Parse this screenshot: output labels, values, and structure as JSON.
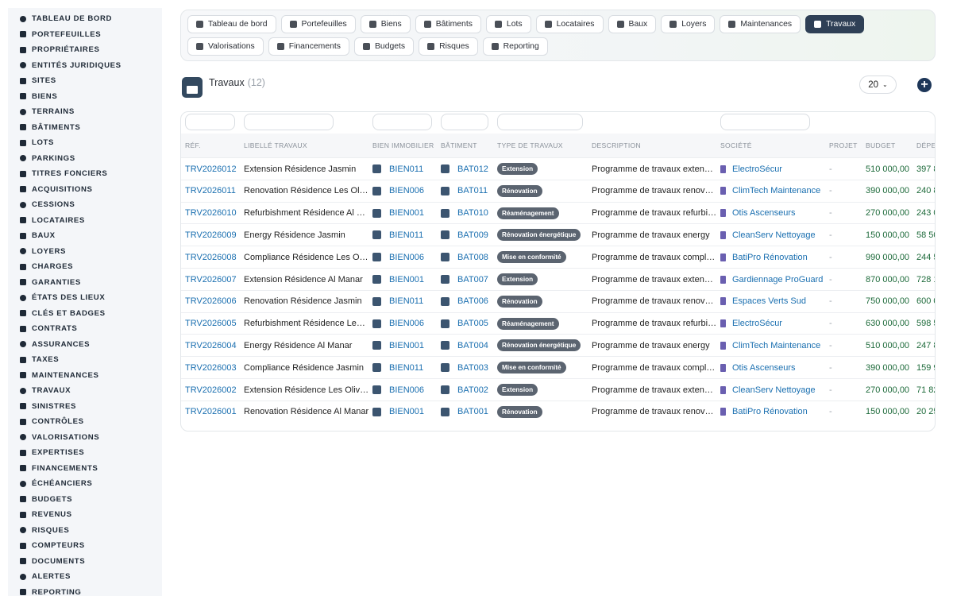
{
  "sidebar": {
    "items": [
      {
        "label": "TABLEAU DE BORD",
        "icon": "gauge-icon"
      },
      {
        "label": "PORTEFEUILLES",
        "icon": "briefcase-icon"
      },
      {
        "label": "PROPRIÉTAIRES",
        "icon": "user-tie-icon"
      },
      {
        "label": "ENTITÉS JURIDIQUES",
        "icon": "landmark-icon"
      },
      {
        "label": "SITES",
        "icon": "city-icon"
      },
      {
        "label": "BIENS",
        "icon": "building-icon"
      },
      {
        "label": "TERRAINS",
        "icon": "vector-square-icon"
      },
      {
        "label": "BÂTIMENTS",
        "icon": "industry-icon"
      },
      {
        "label": "LOTS",
        "icon": "grid-icon"
      },
      {
        "label": "PARKINGS",
        "icon": "parking-icon"
      },
      {
        "label": "TITRES FONCIERS",
        "icon": "file-signature-icon"
      },
      {
        "label": "ACQUISITIONS",
        "icon": "handshake-icon"
      },
      {
        "label": "CESSIONS",
        "icon": "exchange-icon"
      },
      {
        "label": "LOCATAIRES",
        "icon": "users-icon"
      },
      {
        "label": "BAUX",
        "icon": "file-contract-icon"
      },
      {
        "label": "LOYERS",
        "icon": "file-invoice-icon"
      },
      {
        "label": "CHARGES",
        "icon": "receipt-icon"
      },
      {
        "label": "GARANTIES",
        "icon": "shield-icon"
      },
      {
        "label": "ÉTATS DES LIEUX",
        "icon": "clipboard-check-icon"
      },
      {
        "label": "CLÉS ET BADGES",
        "icon": "key-icon"
      },
      {
        "label": "CONTRATS",
        "icon": "file-alt-icon"
      },
      {
        "label": "ASSURANCES",
        "icon": "umbrella-icon"
      },
      {
        "label": "TAXES",
        "icon": "percent-icon"
      },
      {
        "label": "MAINTENANCES",
        "icon": "tools-icon"
      },
      {
        "label": "TRAVAUX",
        "icon": "hard-hat-icon"
      },
      {
        "label": "SINISTRES",
        "icon": "warning-icon"
      },
      {
        "label": "CONTRÔLES",
        "icon": "clipboard-icon"
      },
      {
        "label": "VALORISATIONS",
        "icon": "balance-scale-icon"
      },
      {
        "label": "EXPERTISES",
        "icon": "gavel-icon"
      },
      {
        "label": "FINANCEMENTS",
        "icon": "bank-icon"
      },
      {
        "label": "ÉCHÉANCIERS",
        "icon": "calendar-icon"
      },
      {
        "label": "BUDGETS",
        "icon": "wallet-icon"
      },
      {
        "label": "REVENUS",
        "icon": "money-bill-icon"
      },
      {
        "label": "RISQUES",
        "icon": "exclamation-circle-icon"
      },
      {
        "label": "COMPTEURS",
        "icon": "tachometer-icon"
      },
      {
        "label": "DOCUMENTS",
        "icon": "folder-open-icon"
      },
      {
        "label": "ALERTES",
        "icon": "bell-icon"
      },
      {
        "label": "REPORTING",
        "icon": "chart-pie-icon"
      }
    ]
  },
  "topnav": {
    "tabs": [
      {
        "label": "Tableau de bord",
        "active": false
      },
      {
        "label": "Portefeuilles",
        "active": false
      },
      {
        "label": "Biens",
        "active": false
      },
      {
        "label": "Bâtiments",
        "active": false
      },
      {
        "label": "Lots",
        "active": false
      },
      {
        "label": "Locataires",
        "active": false
      },
      {
        "label": "Baux",
        "active": false
      },
      {
        "label": "Loyers",
        "active": false
      },
      {
        "label": "Maintenances",
        "active": false
      },
      {
        "label": "Travaux",
        "active": true
      },
      {
        "label": "Valorisations",
        "active": false
      },
      {
        "label": "Financements",
        "active": false
      },
      {
        "label": "Budgets",
        "active": false
      },
      {
        "label": "Risques",
        "active": false
      },
      {
        "label": "Reporting",
        "active": false
      }
    ]
  },
  "page": {
    "title": "Travaux",
    "count": "(12)",
    "per_page": "20",
    "add_label": "+"
  },
  "table": {
    "headers": [
      "RÉF.",
      "LIBELLÉ TRAVAUX",
      "BIEN IMMOBILIER",
      "BÂTIMENT",
      "TYPE DE TRAVAUX",
      "DESCRIPTION",
      "SOCIÉTÉ",
      "PROJET",
      "BUDGET",
      "DÉPE"
    ],
    "rows": [
      {
        "ref": "TRV2026012",
        "label": "Extension Résidence Jasmin",
        "bien": "BIEN011",
        "bat": "BAT012",
        "type": "Extension",
        "desc": "Programme de travaux exten…",
        "soc": "ElectroSécur",
        "projet": "-",
        "budget": "510 000,00",
        "dep": "397 8"
      },
      {
        "ref": "TRV2026011",
        "label": "Renovation Résidence Les Ol…",
        "bien": "BIEN006",
        "bat": "BAT011",
        "type": "Rénovation",
        "desc": "Programme de travaux renov…",
        "soc": "ClimTech Maintenance",
        "projet": "-",
        "budget": "390 000,00",
        "dep": "240 8"
      },
      {
        "ref": "TRV2026010",
        "label": "Refurbishment Résidence Al …",
        "bien": "BIEN001",
        "bat": "BAT010",
        "type": "Réaménagement",
        "desc": "Programme de travaux refurbi…",
        "soc": "Otis Ascenseurs",
        "projet": "-",
        "budget": "270 000,00",
        "dep": "243 0"
      },
      {
        "ref": "TRV2026009",
        "label": "Energy Résidence Jasmin",
        "bien": "BIEN011",
        "bat": "BAT009",
        "type": "Rénovation énergétique",
        "desc": "Programme de travaux energy",
        "soc": "CleanServ Nettoyage",
        "projet": "-",
        "budget": "150 000,00",
        "dep": "58 50"
      },
      {
        "ref": "TRV2026008",
        "label": "Compliance Résidence Les O…",
        "bien": "BIEN006",
        "bat": "BAT008",
        "type": "Mise en conformité",
        "desc": "Programme de travaux compl…",
        "soc": "BatiPro Rénovation",
        "projet": "-",
        "budget": "990 000,00",
        "dep": "244 5"
      },
      {
        "ref": "TRV2026007",
        "label": "Extension Résidence Al Manar",
        "bien": "BIEN001",
        "bat": "BAT007",
        "type": "Extension",
        "desc": "Programme de travaux exten…",
        "soc": "Gardiennage ProGuard",
        "projet": "-",
        "budget": "870 000,00",
        "dep": "728 1"
      },
      {
        "ref": "TRV2026006",
        "label": "Renovation Résidence Jasmin",
        "bien": "BIEN011",
        "bat": "BAT006",
        "type": "Rénovation",
        "desc": "Programme de travaux renov…",
        "soc": "Espaces Verts Sud",
        "projet": "-",
        "budget": "750 000,00",
        "dep": "600 0"
      },
      {
        "ref": "TRV2026005",
        "label": "Refurbishment Résidence Le…",
        "bien": "BIEN006",
        "bat": "BAT005",
        "type": "Réaménagement",
        "desc": "Programme de travaux refurbi…",
        "soc": "ElectroSécur",
        "projet": "-",
        "budget": "630 000,00",
        "dep": "598 5"
      },
      {
        "ref": "TRV2026004",
        "label": "Energy Résidence Al Manar",
        "bien": "BIEN001",
        "bat": "BAT004",
        "type": "Rénovation énergétique",
        "desc": "Programme de travaux energy",
        "soc": "ClimTech Maintenance",
        "projet": "-",
        "budget": "510 000,00",
        "dep": "247 8"
      },
      {
        "ref": "TRV2026003",
        "label": "Compliance Résidence Jasmin",
        "bien": "BIEN011",
        "bat": "BAT003",
        "type": "Mise en conformité",
        "desc": "Programme de travaux compl…",
        "soc": "Otis Ascenseurs",
        "projet": "-",
        "budget": "390 000,00",
        "dep": "159 9"
      },
      {
        "ref": "TRV2026002",
        "label": "Extension Résidence Les Oliv…",
        "bien": "BIEN006",
        "bat": "BAT002",
        "type": "Extension",
        "desc": "Programme de travaux exten…",
        "soc": "CleanServ Nettoyage",
        "projet": "-",
        "budget": "270 000,00",
        "dep": "71 82"
      },
      {
        "ref": "TRV2026001",
        "label": "Renovation Résidence Al Manar",
        "bien": "BIEN001",
        "bat": "BAT001",
        "type": "Rénovation",
        "desc": "Programme de travaux renov…",
        "soc": "BatiPro Rénovation",
        "projet": "-",
        "budget": "150 000,00",
        "dep": "20 25"
      }
    ]
  },
  "colors": {
    "active_tab": "#2f4056",
    "link": "#1a6fb0",
    "money": "#1d6a3a",
    "badge": "#5b6470"
  }
}
